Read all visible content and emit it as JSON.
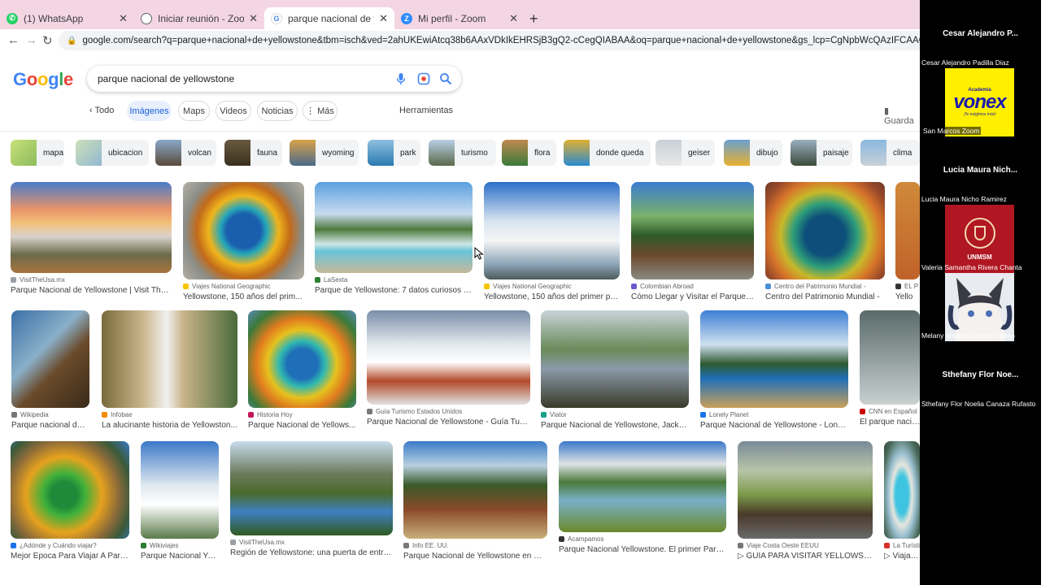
{
  "browser": {
    "tabs": [
      {
        "title": "(1) WhatsApp",
        "icon": "whatsapp-icon",
        "color": "#25d366",
        "active": false
      },
      {
        "title": "Iniciar reunión - Zoom",
        "icon": "globe-icon",
        "color": "#5f6368",
        "active": false
      },
      {
        "title": "parque nacional de yellowstone",
        "icon": "google-icon",
        "color": "#4285f4",
        "active": true
      },
      {
        "title": "Mi perfil - Zoom",
        "icon": "zoom-icon",
        "color": "#2d8cff",
        "active": false
      }
    ],
    "url": "google.com/search?q=parque+nacional+de+yellowstone&tbm=isch&ved=2ahUKEwiAtcq38b6AAxVDkIkEHRSjB3gQ2-cCegQIABAA&oq=parque+nacional+de+yellowstone&gs_lcp=CgNpbWcQAzIFCAAQgAQyBQgAEIAEMgUIABCABDIFCAAQgAQyBQgAEIAE"
  },
  "google": {
    "logo": [
      {
        "ch": "G",
        "c": "#4285f4"
      },
      {
        "ch": "o",
        "c": "#ea4335"
      },
      {
        "ch": "o",
        "c": "#fbbc05"
      },
      {
        "ch": "g",
        "c": "#4285f4"
      },
      {
        "ch": "l",
        "c": "#34a853"
      },
      {
        "ch": "e",
        "c": "#ea4335"
      }
    ],
    "query": "parque nacional de yellowstone",
    "filters": {
      "todo": "Todo",
      "images": "Imágenes",
      "maps": "Maps",
      "videos": "Videos",
      "news": "Noticias",
      "more": "Más",
      "tools": "Herramientas",
      "save": "Guarda"
    },
    "chips": [
      "mapa",
      "ubicacion",
      "volcan",
      "fauna",
      "wyoming",
      "park",
      "turismo",
      "flora",
      "donde queda",
      "geiser",
      "dibujo",
      "paisaje",
      "clima"
    ],
    "results": [
      {
        "source": "VisitTheUsa.mx",
        "title": "Parque Nacional de Yellowstone | Visit The ...",
        "sc": "#9aa0a6"
      },
      {
        "source": "Viajes National Geographic",
        "title": "Yellowstone, 150 años del prim...",
        "sc": "#f6c500"
      },
      {
        "source": "LaSexta",
        "title": "Parque de Yellowstone: 7 datos curiosos q...",
        "sc": "#2e7d32"
      },
      {
        "source": "Viajes National Geographic",
        "title": "Yellowstone, 150 años del primer pa...",
        "sc": "#f6c500"
      },
      {
        "source": "Colombian Abroad",
        "title": "Cómo Llegar y Visitar el Parque ...",
        "sc": "#6a5acd"
      },
      {
        "source": "Centro del Patrimonio Mundial -",
        "title": "Centro del Patrimonio Mundial -",
        "sc": "#4a90d9"
      },
      {
        "source": "EL P",
        "title": "Yello",
        "sc": "#333"
      },
      {
        "source": "Wikipedia",
        "title": "Parque nacional de ...",
        "sc": "#777"
      },
      {
        "source": "Infobae",
        "title": "La alucinante historia de Yellowston...",
        "sc": "#f28c00"
      },
      {
        "source": "Historia Hoy",
        "title": "Parque Nacional de Yellows...",
        "sc": "#c2185b"
      },
      {
        "source": "Guía Turismo Estados Unidos",
        "title": "Parque Nacional de Yellowstone - Guía Turis...",
        "sc": "#777"
      },
      {
        "source": "Viator",
        "title": "Parque Nacional de Yellowstone, Jacks...",
        "sc": "#1b9e8a"
      },
      {
        "source": "Lonely Planet",
        "title": "Parque Nacional de Yellowstone - Lonel...",
        "sc": "#1a73e8"
      },
      {
        "source": "CNN en Español",
        "title": "El parque nacional Yellowstone celebra sus ...",
        "sc": "#cc0000"
      },
      {
        "source": "¿Adónde y Cuándo viajar?",
        "title": "Mejor Epoca Para Viajar A Parq...",
        "sc": "#1a73e8"
      },
      {
        "source": "Wikiviajes",
        "title": "Parque Nacional Ye...",
        "sc": "#2e7d32"
      },
      {
        "source": "VisitTheUsa.mx",
        "title": "Región de Yellowstone: una puerta de entra...",
        "sc": "#9aa0a6"
      },
      {
        "source": "Info EE. UU.",
        "title": "Parque Nacional de Yellowstone en Wy...",
        "sc": "#777"
      },
      {
        "source": "Acampamos",
        "title": "Parque Nacional Yellowstone. El primer Parq...",
        "sc": "#333"
      },
      {
        "source": "Viaje Costa Oeste EEUU",
        "title": "▷ GUÍA PARA VISITAR YELLOWSTO...",
        "sc": "#777"
      },
      {
        "source": "La Turística",
        "title": "▷ Viajar a Parque Nacional Yellowst...",
        "sc": "#d93025"
      }
    ]
  },
  "zoom": {
    "participants": [
      {
        "short": "Cesar Alejandro P...",
        "full": "Cesar Alejandro Padilla Diaz",
        "video": "none"
      },
      {
        "short": "",
        "full": "San Marcos Zoom",
        "video": "vonex"
      },
      {
        "short": "Lucia Maura Nich...",
        "full": "Lucia Maura Nicho Ramirez",
        "video": "none"
      },
      {
        "short": "",
        "full": "Valeria Samantha Rivera Chanta",
        "video": "unmsm"
      },
      {
        "short": "",
        "full": "Melany Magdyel Duran Obeso",
        "video": "melany"
      },
      {
        "short": "Sthefany Flor Noe...",
        "full": "Sthefany Flor Noelia Canaza Rufasto",
        "video": "none"
      }
    ],
    "vonex": {
      "top": "Academia",
      "brand": "vonex",
      "slogan": "¡Te exigimos más!"
    },
    "unmsm": "UNMSM"
  }
}
